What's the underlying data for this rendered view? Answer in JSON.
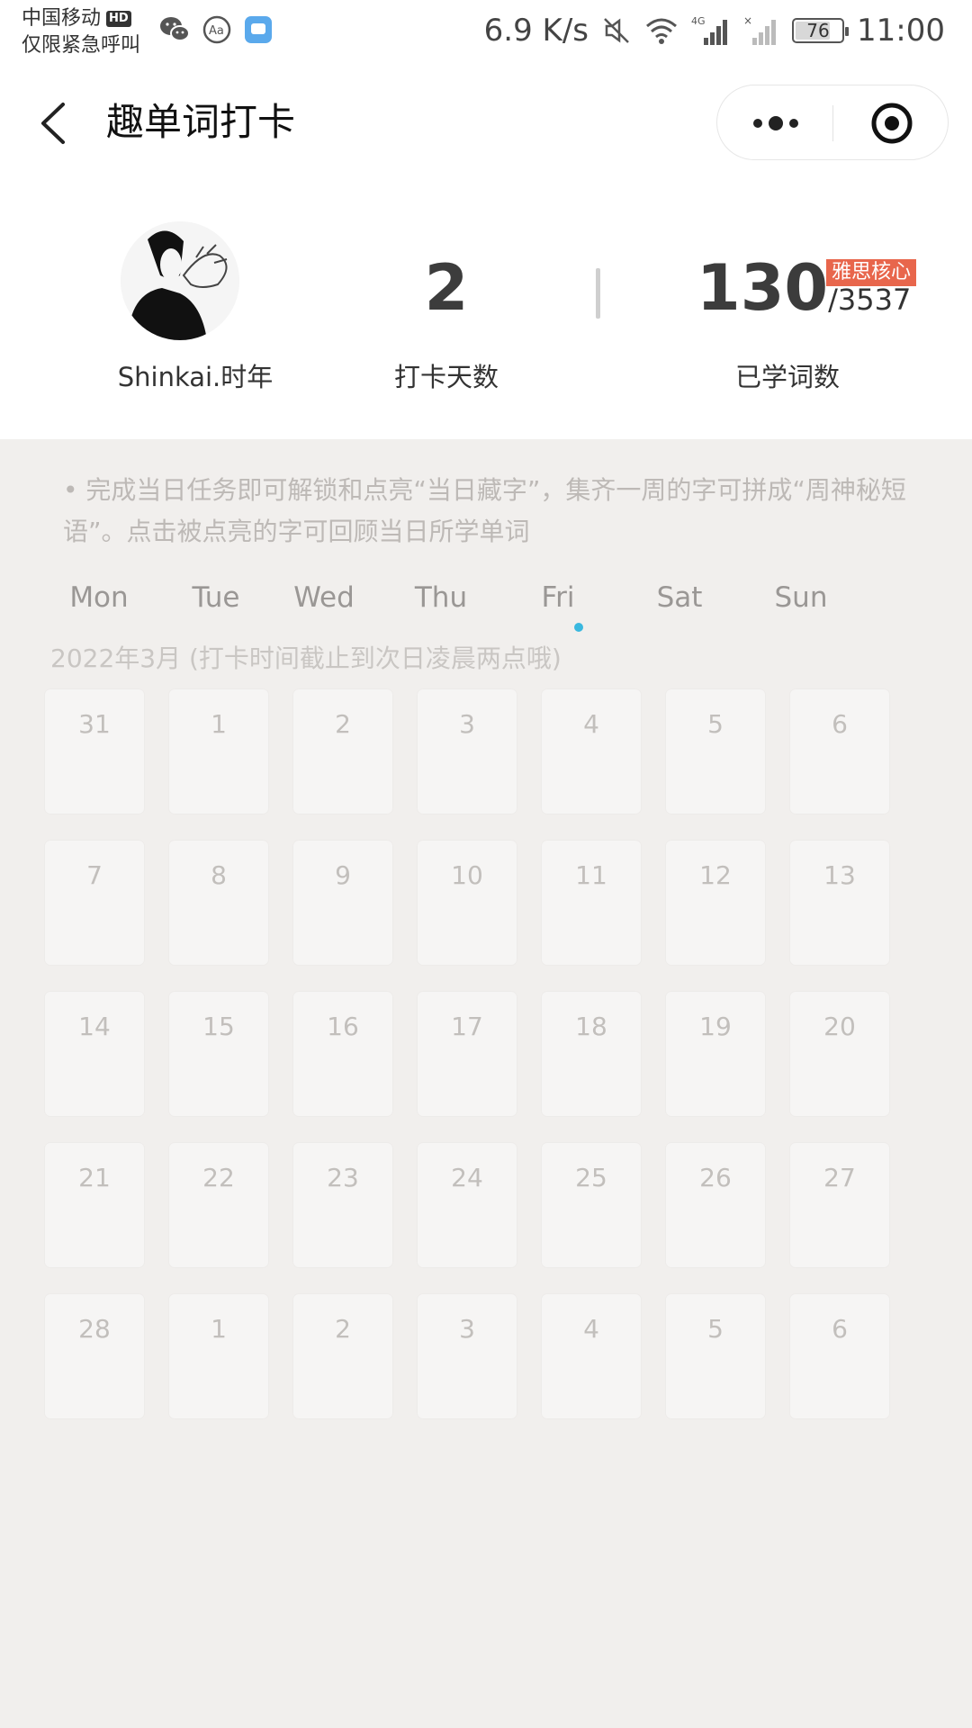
{
  "status_bar": {
    "carrier": "中国移动",
    "hd_badge": "HD",
    "emergency": "仅限紧急呼叫",
    "speed": "6.9 K/s",
    "network": "4G",
    "battery": "76",
    "time": "11:00"
  },
  "nav": {
    "title": "趣单词打卡"
  },
  "profile": {
    "username": "Shinkai.时年"
  },
  "stats": {
    "days_value": "2",
    "days_label": "打卡天数",
    "words_value": "130",
    "words_total": "/3537",
    "words_tag": "雅思核心",
    "words_label": "已学词数"
  },
  "notice": "• 完成当日任务即可解锁和点亮“当日藏字”，集齐一周的字可拼成“周神秘短语”。点击被点亮的字可回顾当日所学单词",
  "calendar": {
    "weekdays": [
      "Mon",
      "Tue",
      "Wed",
      "Thu",
      "Fri",
      "Sat",
      "Sun"
    ],
    "today_index": 4,
    "month_label": "2022年3月 (打卡时间截止到次日凌晨两点哦)",
    "weeks": [
      [
        "31",
        "1",
        "2",
        "3",
        "4",
        "5",
        "6"
      ],
      [
        "7",
        "8",
        "9",
        "10",
        "11",
        "12",
        "13"
      ],
      [
        "14",
        "15",
        "16",
        "17",
        "18",
        "19",
        "20"
      ],
      [
        "21",
        "22",
        "23",
        "24",
        "25",
        "26",
        "27"
      ],
      [
        "28",
        "1",
        "2",
        "3",
        "4",
        "5",
        "6"
      ]
    ]
  },
  "colors": {
    "tag_bg": "#e8664c",
    "today_dot": "#3ab8df",
    "background": "#f1efed"
  }
}
